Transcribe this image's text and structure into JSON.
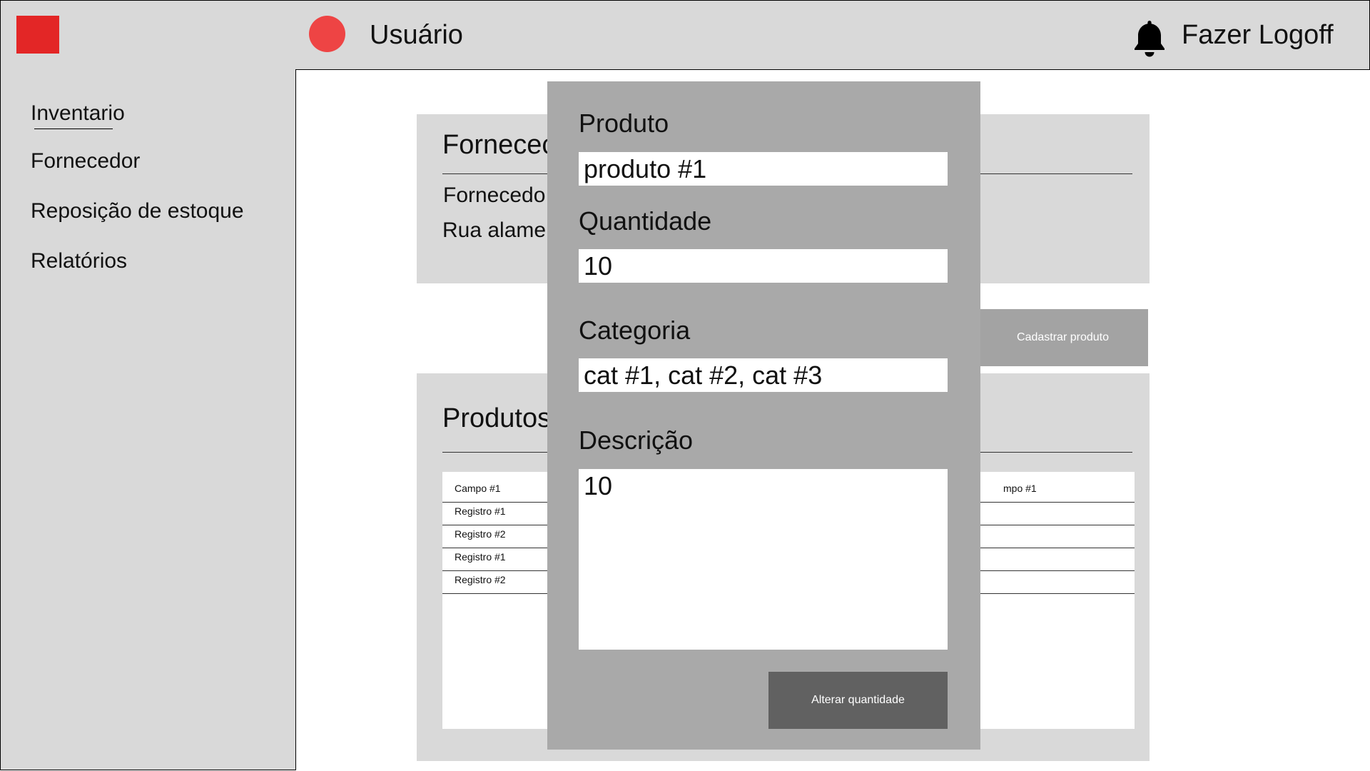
{
  "header": {
    "user_label": "Usuário",
    "logoff_label": "Fazer Logoff",
    "logo_color": "#e32626",
    "avatar_color": "#ee4444"
  },
  "sidebar": {
    "items": [
      {
        "label": "Inventario",
        "active": true
      },
      {
        "label": "Fornecedor"
      },
      {
        "label": "Reposição de estoque"
      },
      {
        "label": "Relatórios"
      }
    ]
  },
  "supplier_card": {
    "title_partial": "Fornecec",
    "line1_partial": "Fornecedo",
    "line2_partial": "Rua alame"
  },
  "register_button": {
    "label": "Cadastrar produto"
  },
  "products_card": {
    "title_partial": "Produtos",
    "table_left": {
      "header": "Campo #1",
      "rows": [
        "Registro #1",
        "Registro #2",
        "Registro #1",
        "Registro #2"
      ]
    },
    "table_right": {
      "header_partial": "mpo #1"
    }
  },
  "modal": {
    "product_label": "Produto",
    "product_value": "produto #1",
    "quantity_label": "Quantidade",
    "quantity_value": "10",
    "category_label": "Categoria",
    "category_value": "cat #1, cat #2, cat #3",
    "description_label": "Descrição",
    "description_value": "10",
    "submit_label": "Alterar quantidade"
  }
}
